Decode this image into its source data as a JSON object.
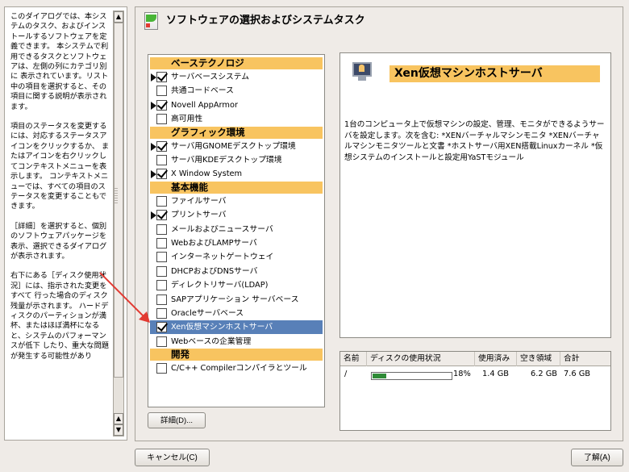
{
  "help": {
    "paragraphs": [
      "このダイアログでは、本システムのタスク、およびインストールするソフトウェアを定義できます。 本システムで利用できるタスクとソフトウェアは、左側の列にカテゴリ別に 表示されています。リスト中の項目を選択すると、その項目に関する説明が表示されます。",
      "項目のステータスを変更するには、対応するステータスアイコンをクリックするか、 またはアイコンを右クリックしてコンテキストメニューを表示します。 コンテキストメニューでは、すべての項目のステータスを変更することもできます。",
      "［詳細］を選択すると、個別のソフトウェアパッケージを表示、選択できるダイアログが表示されます。",
      "右下にある［ディスク使用状況］には、指示された変更をすべて 行った場合のディスク残量が示されます。 ハードディスクのパーティションが満杯、またはほぼ満杯になると、システムのパフォーマンスが低下 したり、重大な問題が発生する可能性があり"
    ]
  },
  "window": {
    "title": "ソフトウェアの選択およびシステムタスク"
  },
  "patterns": {
    "categories": [
      {
        "name": "ベーステクノロジ",
        "items": [
          {
            "label": "サーバベースシステム",
            "checked": true,
            "expand": true
          },
          {
            "label": "共通コードベース",
            "checked": false,
            "expand": false
          },
          {
            "label": "Novell AppArmor",
            "checked": true,
            "expand": true
          },
          {
            "label": "高可用性",
            "checked": false,
            "expand": false
          }
        ]
      },
      {
        "name": "グラフィック環境",
        "items": [
          {
            "label": "サーバ用GNOMEデスクトップ環境",
            "checked": true,
            "expand": true
          },
          {
            "label": "サーバ用KDEデスクトップ環境",
            "checked": false,
            "expand": false
          },
          {
            "label": "X Window System",
            "checked": true,
            "expand": true
          }
        ]
      },
      {
        "name": "基本機能",
        "items": [
          {
            "label": "ファイルサーバ",
            "checked": false,
            "expand": false
          },
          {
            "label": "プリントサーバ",
            "checked": true,
            "expand": true
          },
          {
            "label": "メールおよびニュースサーバ",
            "checked": false,
            "expand": false
          },
          {
            "label": "WebおよびLAMPサーバ",
            "checked": false,
            "expand": false
          },
          {
            "label": "インターネットゲートウェイ",
            "checked": false,
            "expand": false
          },
          {
            "label": "DHCPおよびDNSサーバ",
            "checked": false,
            "expand": false
          },
          {
            "label": "ディレクトリサーバ(LDAP)",
            "checked": false,
            "expand": false
          },
          {
            "label": "SAPアプリケーション サーバベース",
            "checked": false,
            "expand": false
          },
          {
            "label": "Oracleサーバベース",
            "checked": false,
            "expand": false
          },
          {
            "label": "Xen仮想マシンホストサーバ",
            "checked": true,
            "expand": false,
            "selected": true
          },
          {
            "label": "Webベースの企業管理",
            "checked": false,
            "expand": false
          }
        ]
      },
      {
        "name": "開発",
        "items": [
          {
            "label": "C/C++ Compilerコンパイラとツール",
            "checked": false,
            "expand": false
          }
        ]
      }
    ]
  },
  "details_button": "詳細(D)...",
  "description": {
    "title": "Xen仮想マシンホストサーバ",
    "body": "1台のコンピュータ上で仮想マシンの設定、管理、モニタができるようサーバを設定します。次を含む: *XENバーチャルマシンモニタ *XENバーチャルマシンモニタツールと文書 *ホストサーバ用XEN搭載Linuxカーネル *仮想システムのインストールと設定用YaSTモジュール"
  },
  "disk": {
    "headers": [
      "名前",
      "ディスクの使用状況",
      "使用済み",
      "空き領域",
      "合計"
    ],
    "rows": [
      {
        "name": "/",
        "usage_percent": 18,
        "usage_label": "18%",
        "used": "1.4 GB",
        "free": "6.2 GB",
        "total": "7.6 GB"
      }
    ]
  },
  "buttons": {
    "cancel": "キャンセル(C)",
    "accept": "了解(A)"
  },
  "colors": {
    "category_bg": "#f8c460",
    "selection_bg": "#5880b8",
    "annotation_arrow": "#e23a32"
  }
}
